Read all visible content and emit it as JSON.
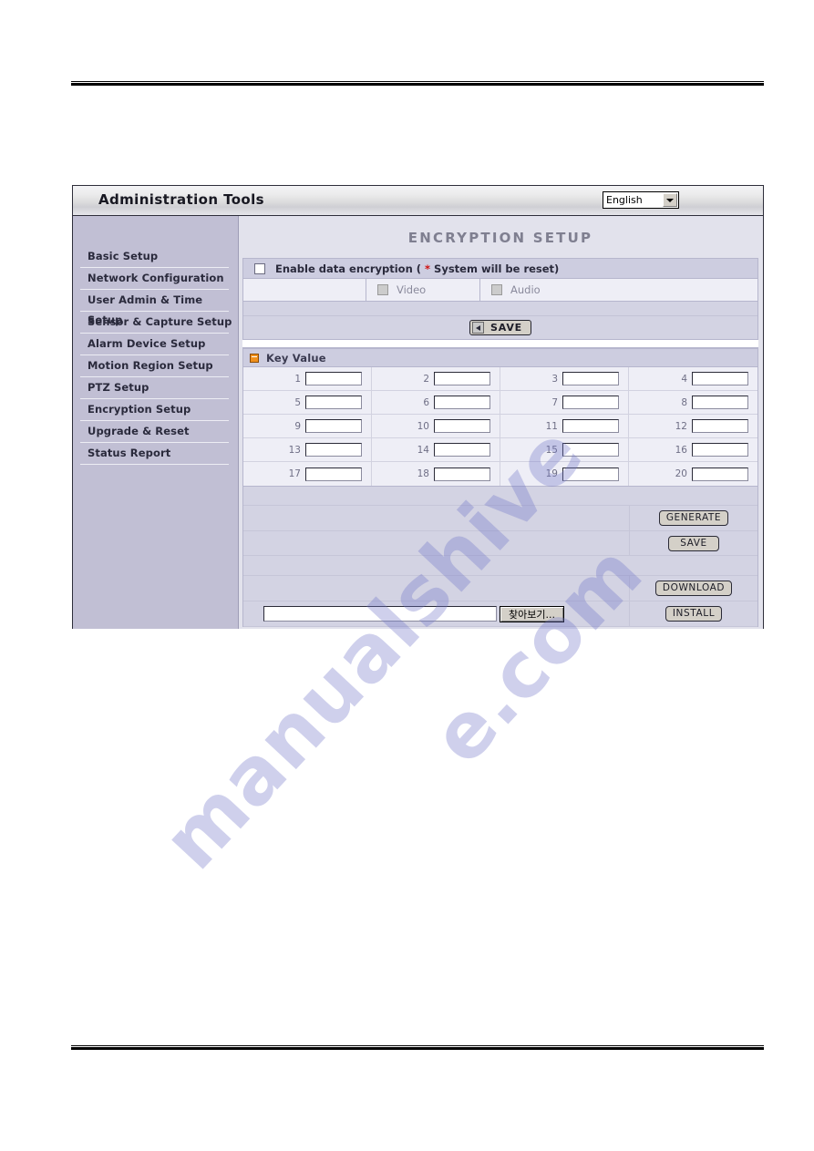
{
  "window": {
    "title": "Administration Tools",
    "language": {
      "selected": "English",
      "options": [
        "English"
      ],
      "arrow_icon": "chevron-down-icon"
    }
  },
  "sidebar": {
    "items": [
      {
        "label": "Basic Setup"
      },
      {
        "label": "Network Configuration"
      },
      {
        "label": "User Admin & Time Setup"
      },
      {
        "label": "Sensor & Capture Setup"
      },
      {
        "label": "Alarm Device Setup"
      },
      {
        "label": "Motion Region Setup"
      },
      {
        "label": "PTZ Setup"
      },
      {
        "label": "Encryption Setup"
      },
      {
        "label": "Upgrade & Reset"
      },
      {
        "label": "Status Report"
      }
    ]
  },
  "main": {
    "page_title": "ENCRYPTION SETUP",
    "enable_row": {
      "checkbox_name": "enable-data-encryption-checkbox",
      "label_before": "Enable data encryption ( ",
      "asterisk": "*",
      "label_after": " System will be reset)"
    },
    "av_row": {
      "video_label": "Video",
      "audio_label": "Audio"
    },
    "save_main": {
      "label": "SAVE",
      "icon": "arrow-left-icon"
    },
    "key_value": {
      "section_icon": "orange-square-icon",
      "section_title": "Key Value",
      "numbers": [
        [
          "1",
          "2",
          "3",
          "4"
        ],
        [
          "5",
          "6",
          "7",
          "8"
        ],
        [
          "9",
          "10",
          "11",
          "12"
        ],
        [
          "13",
          "14",
          "15",
          "16"
        ],
        [
          "17",
          "18",
          "19",
          "20"
        ]
      ],
      "values": [
        [
          "",
          "",
          "",
          ""
        ],
        [
          "",
          "",
          "",
          ""
        ],
        [
          "",
          "",
          "",
          ""
        ],
        [
          "",
          "",
          "",
          ""
        ],
        [
          "",
          "",
          "",
          ""
        ]
      ]
    },
    "actions": {
      "generate": "GENERATE",
      "save": "SAVE",
      "download": "DOWNLOAD",
      "install": "INSTALL",
      "browse": "찾아보기...",
      "file_path": ""
    }
  },
  "watermark": {
    "line_a": "manualshive",
    "line_b": "e.com"
  },
  "colors": {
    "accent_orange": "#f0901c",
    "asterisk_red": "#d01010",
    "sidebar_bg": "#c1bfd4",
    "content_bg": "#e2e2ec",
    "panel_row": "#cdcde0"
  }
}
